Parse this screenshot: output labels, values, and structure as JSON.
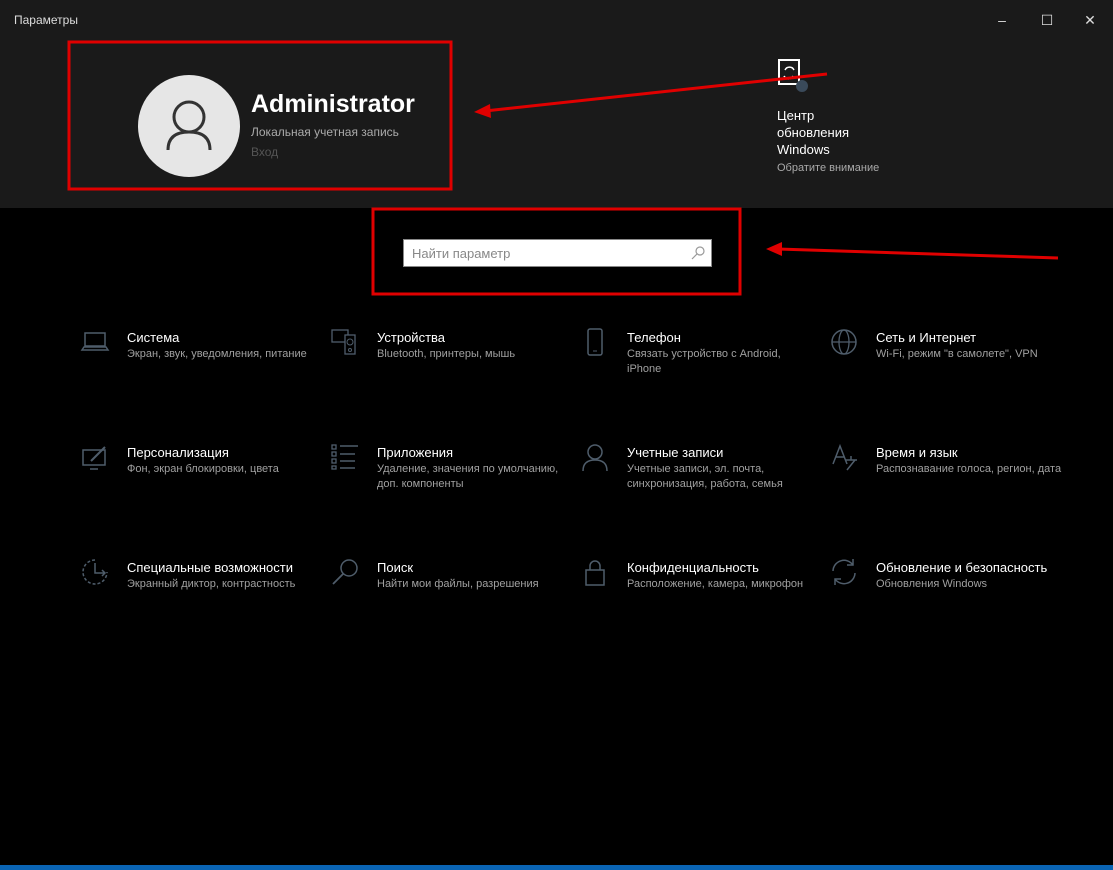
{
  "window": {
    "title": "Параметры",
    "minimize": "–",
    "maximize": "☐",
    "close": "✕"
  },
  "user": {
    "name": "Administrator",
    "account_type": "Локальная учетная запись",
    "login": "Вход"
  },
  "update": {
    "title": "Центр обновления Windows",
    "subtitle": "Обратите внимание"
  },
  "search": {
    "placeholder": "Найти параметр"
  },
  "tiles": [
    {
      "title": "Система",
      "desc": "Экран, звук, уведомления, питание",
      "icon": "laptop-icon"
    },
    {
      "title": "Устройства",
      "desc": "Bluetooth, принтеры, мышь",
      "icon": "devices-icon"
    },
    {
      "title": "Телефон",
      "desc": "Связать устройство с Android, iPhone",
      "icon": "phone-icon"
    },
    {
      "title": "Сеть и Интернет",
      "desc": "Wi-Fi, режим \"в самолете\", VPN",
      "icon": "globe-icon"
    },
    {
      "title": "Персонализация",
      "desc": "Фон, экран блокировки, цвета",
      "icon": "personalization-icon"
    },
    {
      "title": "Приложения",
      "desc": "Удаление, значения по умолчанию, доп. компоненты",
      "icon": "apps-list-icon"
    },
    {
      "title": "Учетные записи",
      "desc": "Учетные записи, эл. почта, синхронизация, работа, семья",
      "icon": "person-icon"
    },
    {
      "title": "Время и язык",
      "desc": "Распознавание голоса, регион, дата",
      "icon": "time-language-icon"
    },
    {
      "title": "Специальные возможности",
      "desc": "Экранный диктор, контрастность",
      "icon": "accessibility-icon"
    },
    {
      "title": "Поиск",
      "desc": "Найти мои файлы, разрешения",
      "icon": "search-icon"
    },
    {
      "title": "Конфиденциальность",
      "desc": "Расположение, камера, микрофон",
      "icon": "lock-icon"
    },
    {
      "title": "Обновление и безопасность",
      "desc": "Обновления Windows",
      "icon": "refresh-icon"
    }
  ],
  "colors": {
    "icon": "#4f5d6b",
    "annotation": "#e00000",
    "accent": "#0a64b4"
  }
}
